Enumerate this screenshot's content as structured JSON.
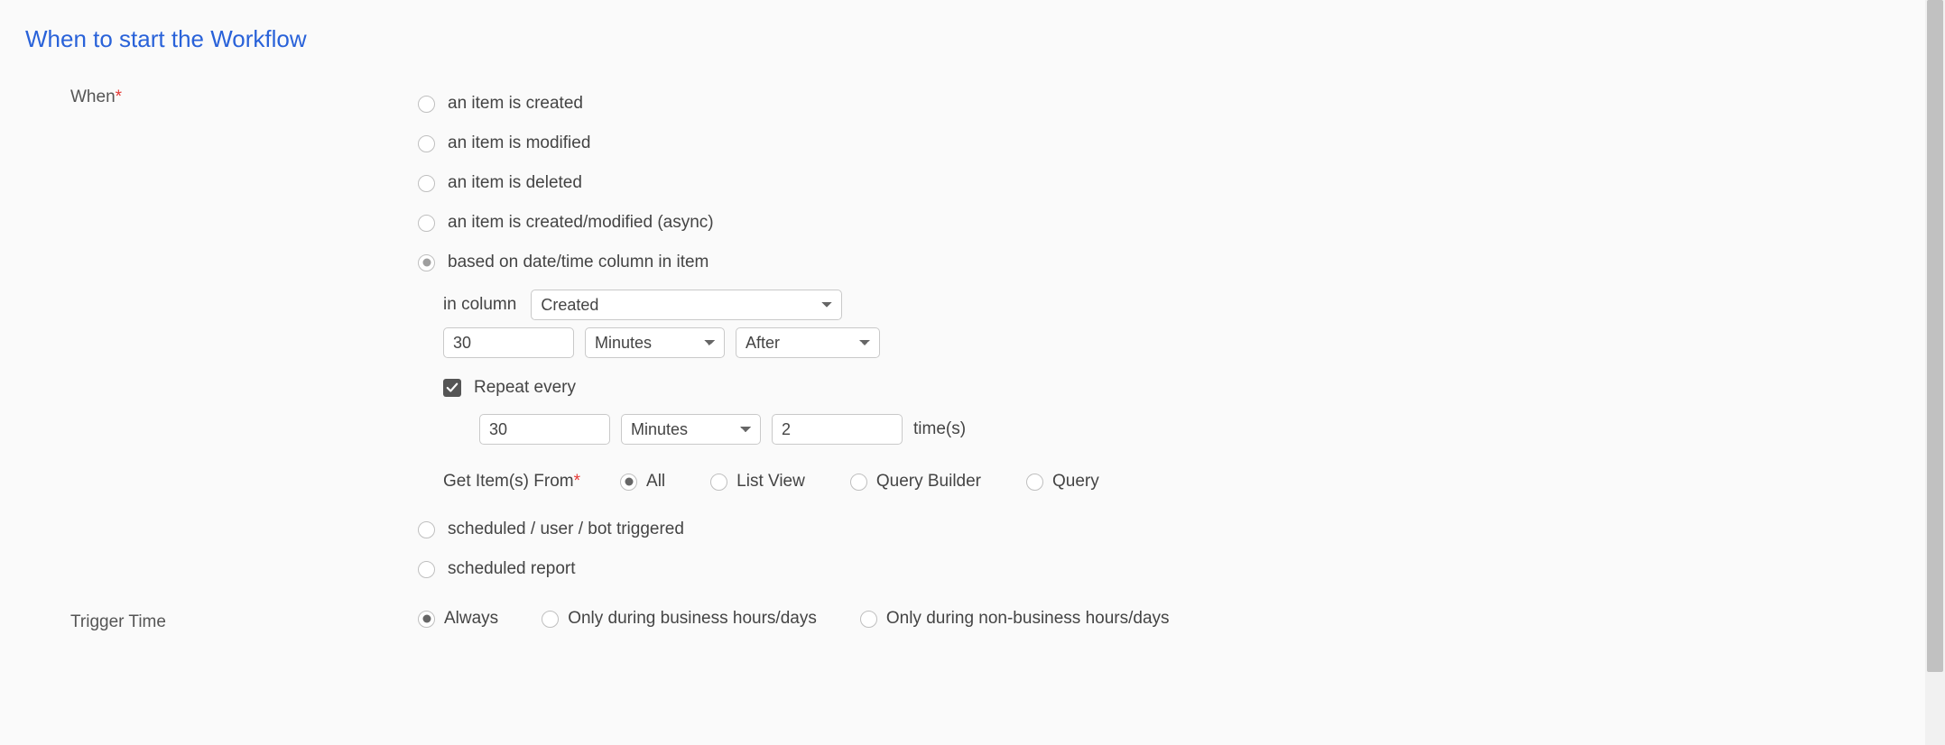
{
  "section_title": "When to start the Workflow",
  "when": {
    "label": "When",
    "options": {
      "created": "an item is created",
      "modified": "an item is modified",
      "deleted": "an item is deleted",
      "async": "an item is created/modified (async)",
      "date": "based on date/time column in item",
      "scheduled_user_bot": "scheduled / user / bot triggered",
      "scheduled_report": "scheduled report"
    },
    "date_sub": {
      "in_column_label": "in column",
      "in_column_value": "Created",
      "interval_value": "30",
      "interval_unit": "Minutes",
      "relation": "After",
      "repeat_label": "Repeat every",
      "repeat_value": "30",
      "repeat_unit": "Minutes",
      "repeat_times_value": "2",
      "times_suffix": "time(s)",
      "get_items_label": "Get Item(s) From",
      "get_items": {
        "all": "All",
        "list_view": "List View",
        "query_builder": "Query Builder",
        "query": "Query"
      }
    }
  },
  "trigger_time": {
    "label": "Trigger Time",
    "options": {
      "always": "Always",
      "business": "Only during business hours/days",
      "non_business": "Only during non-business hours/days"
    }
  }
}
